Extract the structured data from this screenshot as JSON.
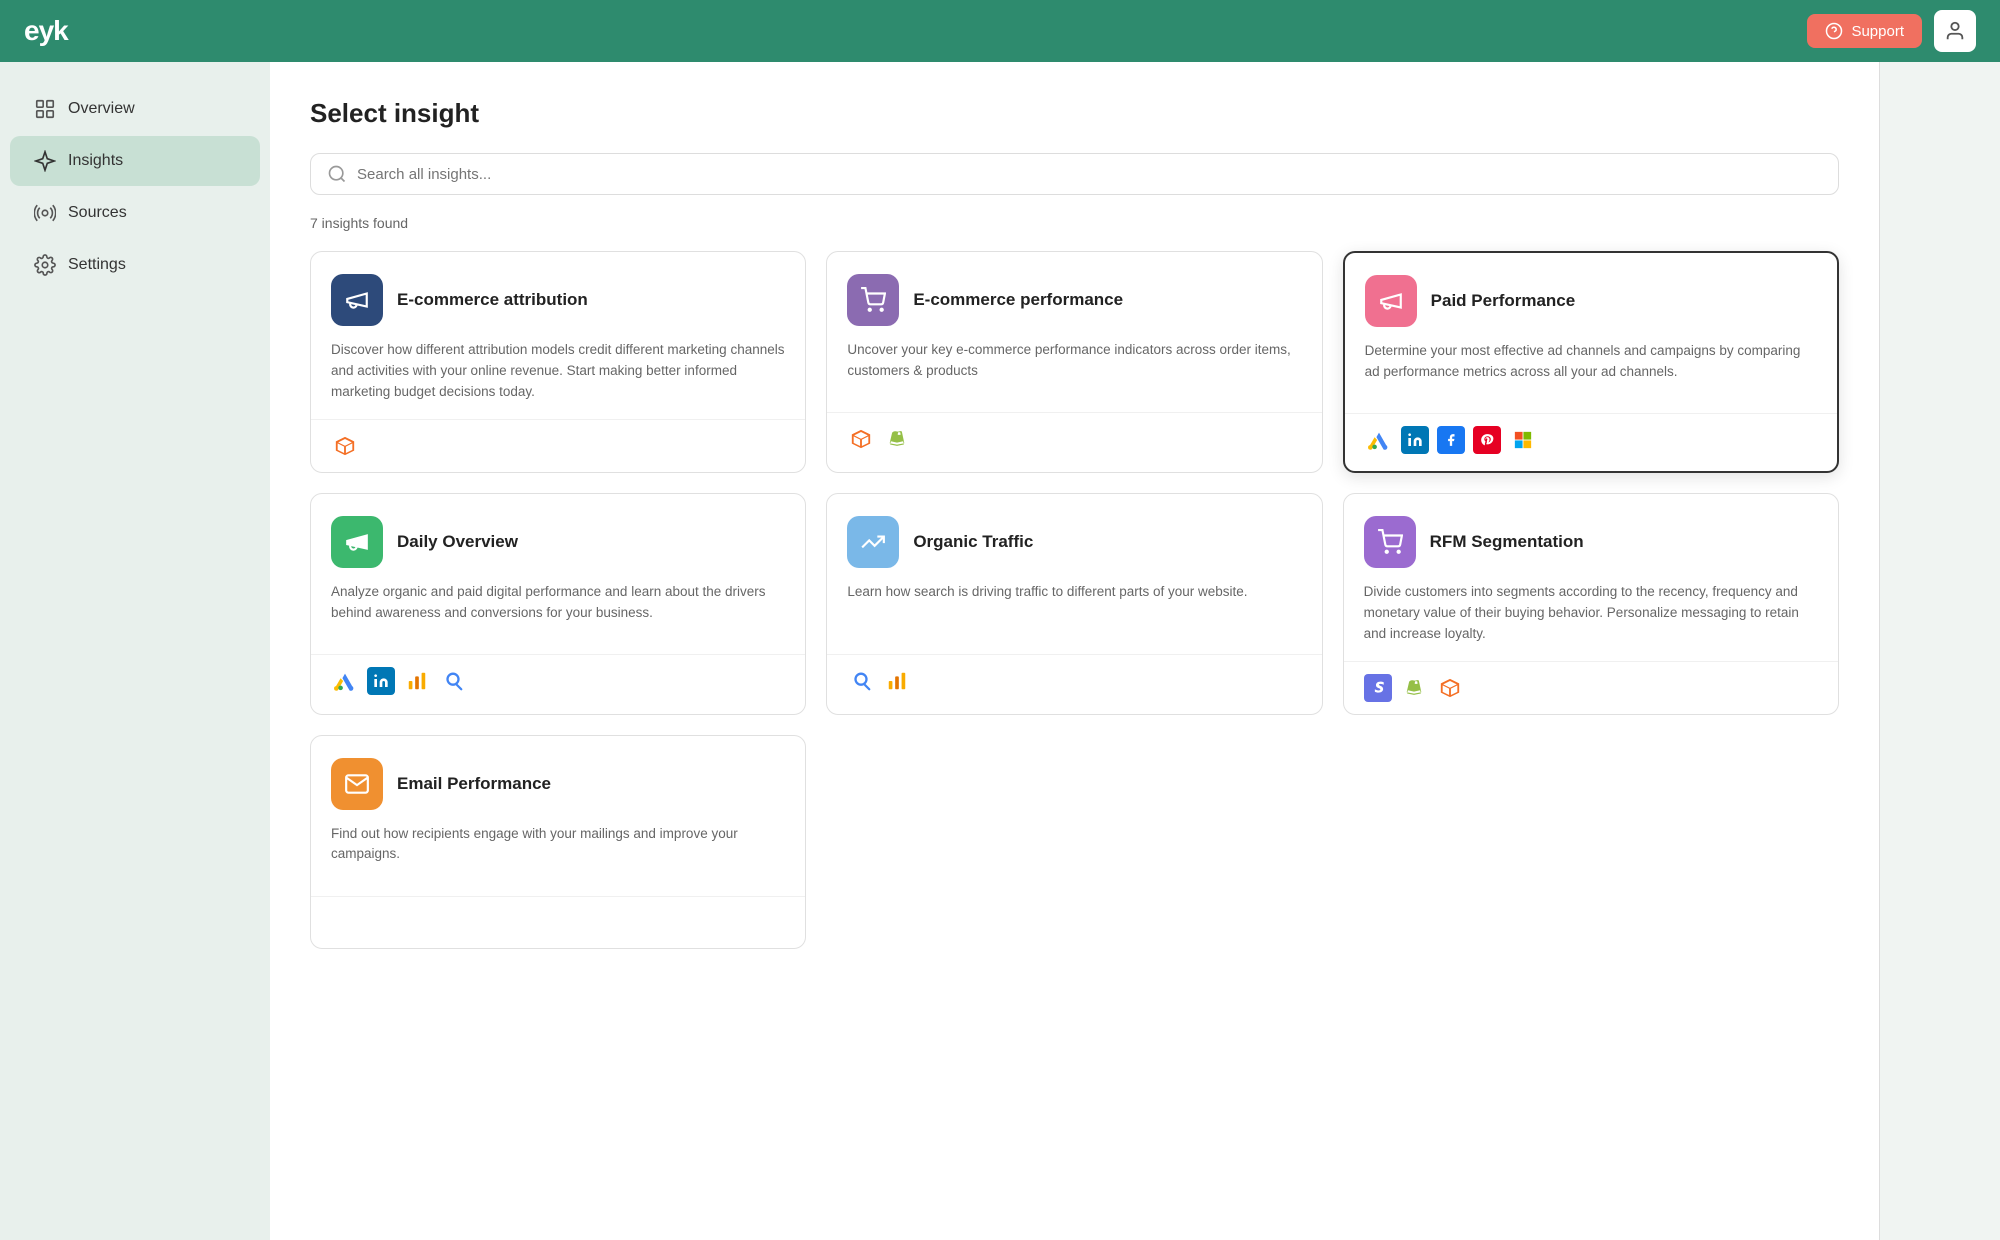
{
  "header": {
    "logo": "eyk",
    "support_label": "Support",
    "support_icon": "question-circle-icon",
    "user_icon": "user-icon"
  },
  "sidebar": {
    "items": [
      {
        "id": "overview",
        "label": "Overview",
        "icon": "grid-icon",
        "active": false
      },
      {
        "id": "insights",
        "label": "Insights",
        "icon": "sparkle-icon",
        "active": true
      },
      {
        "id": "sources",
        "label": "Sources",
        "icon": "broadcast-icon",
        "active": false
      },
      {
        "id": "settings",
        "label": "Settings",
        "icon": "gear-icon",
        "active": false
      }
    ]
  },
  "main": {
    "title": "Select insight",
    "search_placeholder": "Search all insights...",
    "results_count": "7 insights found",
    "cards": [
      {
        "id": "ecommerce-attribution",
        "title": "E-commerce attribution",
        "icon_bg": "icon-blue",
        "description": "Discover how different attribution models credit different marketing channels and activities with your online revenue. Start making better informed marketing budget decisions today.",
        "integrations": [
          "magento"
        ],
        "selected": false
      },
      {
        "id": "ecommerce-performance",
        "title": "E-commerce performance",
        "icon_bg": "icon-purple",
        "description": "Uncover your key e-commerce performance indicators across order items, customers & products",
        "integrations": [
          "magento",
          "shopify"
        ],
        "selected": false
      },
      {
        "id": "paid-performance",
        "title": "Paid Performance",
        "icon_bg": "icon-pink",
        "description": "Determine your most effective ad channels and campaigns by comparing ad performance metrics across all your ad channels.",
        "integrations": [
          "google-ads",
          "linkedin",
          "facebook",
          "pinterest",
          "microsoft"
        ],
        "selected": true
      },
      {
        "id": "daily-overview",
        "title": "Daily Overview",
        "icon_bg": "icon-green",
        "description": "Analyze organic and paid digital performance and learn about the drivers behind awareness and conversions for your business.",
        "integrations": [
          "google-ads",
          "linkedin",
          "ga4",
          "google-search-console"
        ],
        "selected": false
      },
      {
        "id": "organic-traffic",
        "title": "Organic Traffic",
        "icon_bg": "icon-lightblue",
        "description": "Learn how search is driving traffic to different parts of your website.",
        "integrations": [
          "google-search-console",
          "ga4"
        ],
        "selected": false
      },
      {
        "id": "rfm-segmentation",
        "title": "RFM Segmentation",
        "icon_bg": "icon-purple2",
        "description": "Divide customers into segments according to the recency, frequency and monetary value of their buying behavior. Personalize messaging to retain and increase loyalty.",
        "integrations": [
          "stripe",
          "shopify",
          "magento"
        ],
        "selected": false
      },
      {
        "id": "email-performance",
        "title": "Email Performance",
        "icon_bg": "icon-orange",
        "description": "Find out how recipients engage with your mailings and improve your campaigns.",
        "integrations": [],
        "selected": false
      }
    ]
  }
}
